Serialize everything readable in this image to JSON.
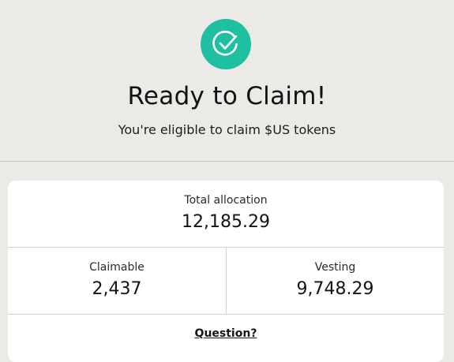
{
  "header": {
    "icon": "check-circle-icon",
    "title": "Ready to Claim!",
    "subtitle": "You're eligible to claim $US tokens"
  },
  "allocation": {
    "total_label": "Total allocation",
    "total_value": "12,185.29",
    "claimable_label": "Claimable",
    "claimable_value": "2,437",
    "vesting_label": "Vesting",
    "vesting_value": "9,748.29"
  },
  "footer": {
    "question_link": "Question?"
  },
  "colors": {
    "background": "#ebeae7",
    "accent": "#1fbfa1",
    "card": "#ffffff"
  }
}
